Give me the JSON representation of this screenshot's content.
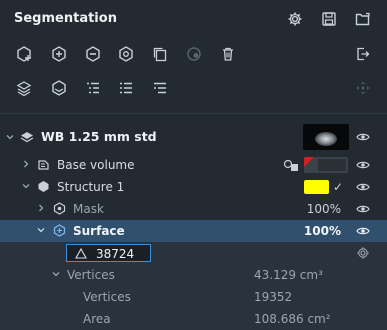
{
  "panel": {
    "title": "Segmentation"
  },
  "header_icons": [
    "gear-icon",
    "save-icon",
    "folder-open-icon"
  ],
  "toolbar_row1": [
    "add-segment-icon",
    "cube-plus-icon",
    "cube-minus-icon",
    "cube-gear-icon",
    "copy-icon",
    "disabled-circle-icon",
    "delete-icon",
    "export-icon"
  ],
  "toolbar_row2": [
    "layers-plus-icon",
    "layers-settings-icon",
    "list-indent-icon",
    "list-icon",
    "list-outdent-icon",
    "move-icon"
  ],
  "tree": {
    "root": {
      "label": "WB 1.25 mm std"
    },
    "base_volume": {
      "label": "Base volume"
    },
    "structure": {
      "label": "Structure 1",
      "color": "#ffff00",
      "check": "✓"
    },
    "mask": {
      "label": "Mask",
      "percent": "100%"
    },
    "surface": {
      "label": "Surface",
      "percent": "100%"
    },
    "triangles": {
      "value": "38724"
    },
    "vertices_group": {
      "label": "Vertices",
      "value": "43.129 cm³"
    },
    "vertices": {
      "label": "Vertices",
      "value": "19352"
    },
    "area": {
      "label": "Area",
      "value": "108.686 cm²"
    }
  },
  "colors": {
    "accent": "#3d8fe0",
    "selected_row": "#31506e",
    "background": "#232a32"
  }
}
